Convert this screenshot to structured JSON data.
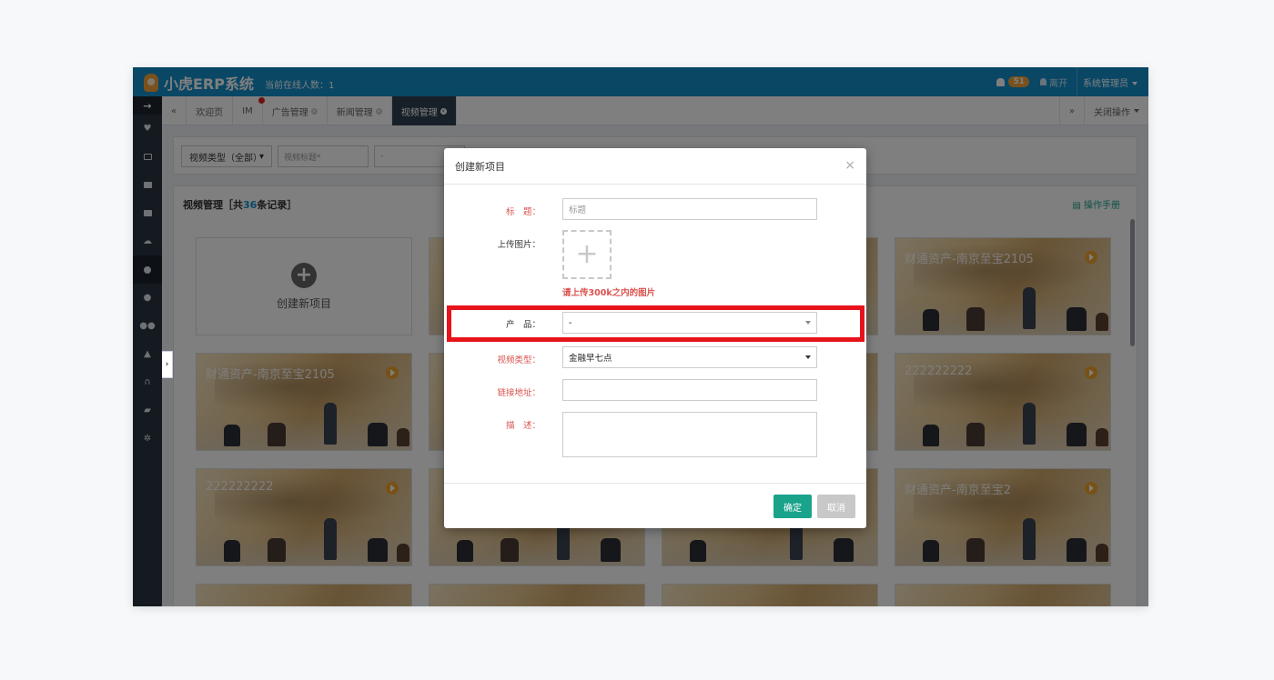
{
  "header": {
    "app_name": "小虎ERP系统",
    "online_text": "当前在线人数：1",
    "notification_count": "51",
    "leave_label": "离开",
    "user_label": "系统管理员"
  },
  "sidebar": {
    "items": [
      "arrow-right-icon",
      "heart-icon",
      "desktop-icon",
      "list-icon",
      "book-icon",
      "cloud-icon",
      "globe-icon",
      "user-icon",
      "users-icon",
      "sitemap-icon",
      "headphones-icon",
      "cart-icon",
      "gear-icon"
    ],
    "active_index": 6
  },
  "tabs": {
    "prev_label": "«",
    "items": [
      {
        "label": "欢迎页"
      },
      {
        "label": "IM"
      },
      {
        "label": "广告管理"
      },
      {
        "label": "新闻管理"
      },
      {
        "label": "视频管理"
      }
    ],
    "next_label": "»",
    "close_ops_label": "关闭操作"
  },
  "filter": {
    "type_select": "视频类型（全部）",
    "title_placeholder": "视频标题*",
    "extra_value": "-"
  },
  "list": {
    "title_prefix": "视频管理［共",
    "count": "36",
    "title_suffix": "条记录］",
    "manual_label": "操作手册",
    "create_label": "创建新项目",
    "cards": [
      {
        "title": "财通资产-南京至宝2105"
      },
      {
        "title": "财通资产-南京至宝2105"
      },
      {
        "title": "222222222"
      },
      {
        "title": "222222222"
      },
      {
        "title": "财通资产-南京至宝2"
      }
    ]
  },
  "modal": {
    "title": "创建新项目",
    "close_symbol": "×",
    "title_label": "标　题：",
    "title_placeholder": "标题",
    "upload_label": "上传图片：",
    "upload_hint": "请上传300k之内的图片",
    "product_label": "产　品：",
    "product_value": "-",
    "video_type_label": "视频类型：",
    "video_type_value": "金融早七点",
    "link_label": "链接地址：",
    "desc_label": "描　述：",
    "ok_label": "确定",
    "cancel_label": "取消"
  },
  "colors": {
    "header_blue": "#138fca",
    "sidebar_dark": "#2b3542",
    "confirm_green": "#1aa38b",
    "highlight_red": "#e8131a",
    "required_red": "#d9534f"
  }
}
